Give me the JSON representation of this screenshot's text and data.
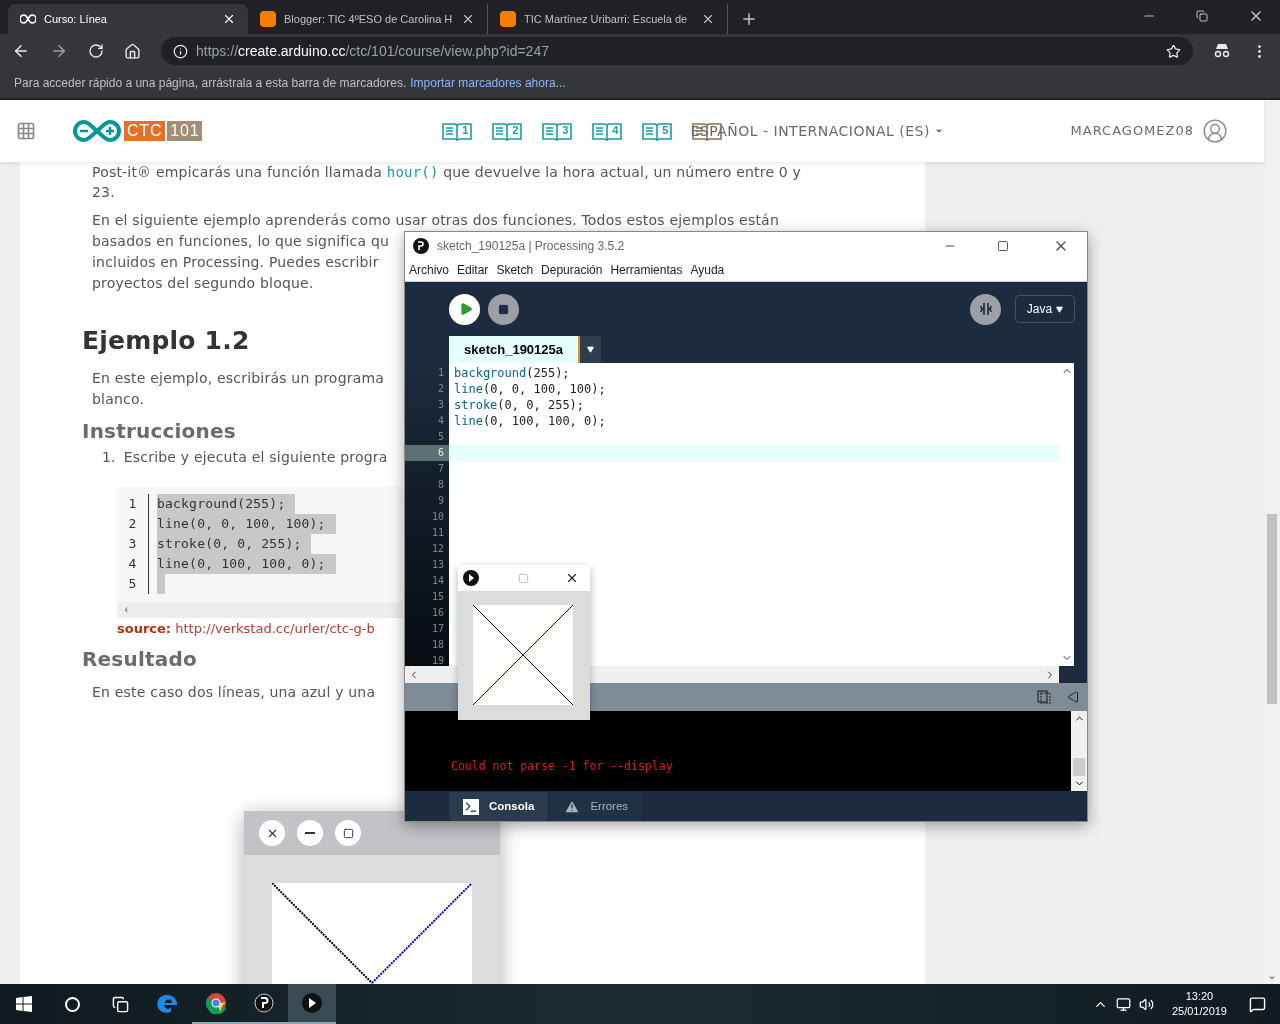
{
  "browser": {
    "tabs": [
      {
        "title": "Curso: Línea",
        "selected": true
      },
      {
        "title": "Blogger: TIC 4ºESO de Carolina H",
        "selected": false
      },
      {
        "title": "TIC Martínez Uribarri: Escuela de",
        "selected": false
      }
    ],
    "address": {
      "scheme": "https://",
      "host": "create.arduino.cc",
      "path": "/ctc/101/course/view.php?id=247"
    },
    "bookmarks_bar": {
      "text": "Para acceder rápido a una página, arrástrala a esta barra de marcadores.",
      "link": "Importar marcadores ahora..."
    }
  },
  "site_header": {
    "logo": {
      "brand": "CTC",
      "number": "101"
    },
    "chapters": [
      "1",
      "2",
      "3",
      "4",
      "5"
    ],
    "language": "ESPAÑOL - INTERNACIONAL (ES)",
    "user": "MARCAGOMEZ08"
  },
  "article": [
    {
      "kind": "rich_paragraph",
      "lines": [
        [
          {
            "text": "Post-it® empicarás una función llamada ",
            "code": false
          },
          {
            "text": "hour()",
            "code": true
          },
          {
            "text": " que devuelve la hora actual, un número entre 0 y",
            "code": false
          }
        ],
        [
          {
            "text": "23.",
            "code": false
          }
        ]
      ]
    },
    {
      "kind": "paragraph",
      "lines": [
        "En el siguiente ejemplo aprenderás como usar otras dos funciones. Todos estos ejemplos están",
        "basados en funciones, lo que significa qu",
        "incluidos en Processing. Puedes escribir",
        "proyectos del segundo bloque."
      ]
    },
    {
      "kind": "heading",
      "text": "Ejemplo 1.2"
    },
    {
      "kind": "paragraph",
      "lines": [
        "En este ejemplo, escribirás un programa",
        "blanco."
      ]
    },
    {
      "kind": "subheading",
      "text": "Instrucciones"
    },
    {
      "kind": "list_item",
      "number": "1.",
      "text": "Escribe y ejecuta el siguiente progra"
    },
    {
      "kind": "code",
      "line_numbers": [
        "1",
        "2",
        "3",
        "4",
        "5"
      ],
      "lines": [
        "background(255);",
        "line(0, 0, 100, 100);",
        "stroke(0, 0, 255);",
        "line(0, 100, 100, 0);"
      ]
    },
    {
      "kind": "source",
      "label": "source:",
      "link": "http://verkstad.cc/urler/ctc-g-b"
    },
    {
      "kind": "subheading",
      "text": "Resultado"
    },
    {
      "kind": "paragraph",
      "lines": [
        "En este caso dos líneas, una azul y una"
      ]
    }
  ],
  "processing": {
    "title": "sketch_190125a | Processing 3.5.2",
    "menu": [
      "Archivo",
      "Editar",
      "Sketch",
      "Depuración",
      "Herramientas",
      "Ayuda"
    ],
    "mode": "Java",
    "tab": "sketch_190125a",
    "code": [
      "background(255);",
      "line(0, 0, 100, 100);",
      "stroke(0, 0, 255);",
      "line(0, 100, 100, 0);"
    ],
    "line_numbers": [
      {
        "number": "1",
        "selected": false
      },
      {
        "number": "2",
        "selected": false
      },
      {
        "number": "3",
        "selected": false
      },
      {
        "number": "4",
        "selected": false
      },
      {
        "number": "5",
        "selected": false
      },
      {
        "number": "6",
        "selected": true
      },
      {
        "number": "7",
        "selected": false
      },
      {
        "number": "8",
        "selected": false
      },
      {
        "number": "9",
        "selected": false
      },
      {
        "number": "10",
        "selected": false
      },
      {
        "number": "11",
        "selected": false
      },
      {
        "number": "12",
        "selected": false
      },
      {
        "number": "13",
        "selected": false
      },
      {
        "number": "14",
        "selected": false
      },
      {
        "number": "15",
        "selected": false
      },
      {
        "number": "16",
        "selected": false
      },
      {
        "number": "17",
        "selected": false
      },
      {
        "number": "18",
        "selected": false
      },
      {
        "number": "19",
        "selected": false
      }
    ],
    "console": "Could not parse -1 for --display",
    "bottom_tabs": [
      {
        "label": "Consola",
        "selected": true
      },
      {
        "label": "Errores",
        "selected": false
      }
    ]
  },
  "taskbar": {
    "time": "13:20",
    "date": "25/01/2019"
  }
}
